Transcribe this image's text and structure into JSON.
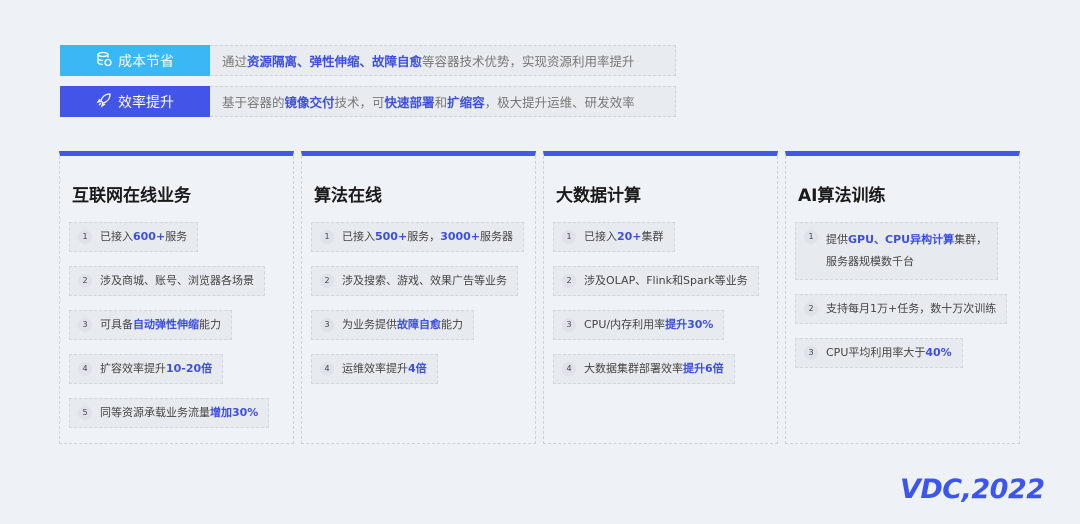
{
  "banners": [
    {
      "label": "成本节省",
      "icon": "database-coin-icon",
      "color": "#3ab7f5",
      "segments": [
        {
          "t": "通过"
        },
        {
          "t": "资源隔离、弹性伸缩、故障自愈",
          "hl": true
        },
        {
          "t": "等容器技术优势，实现资源利用率提升"
        }
      ]
    },
    {
      "label": "效率提升",
      "icon": "rocket-icon",
      "color": "#4255e8",
      "segments": [
        {
          "t": "基于容器的"
        },
        {
          "t": "镜像交付",
          "hl": true
        },
        {
          "t": "技术，可"
        },
        {
          "t": "快速部署",
          "hl": true
        },
        {
          "t": "和"
        },
        {
          "t": "扩缩容",
          "hl": true
        },
        {
          "t": "，极大提升运维、研发效率"
        }
      ]
    }
  ],
  "cards": [
    {
      "title": "互联网在线业务",
      "items": [
        [
          [
            {
              "t": "已接入"
            },
            {
              "t": "600+",
              "hl": true
            },
            {
              "t": "服务"
            }
          ]
        ],
        [
          [
            {
              "t": "涉及商城、账号、浏览器各场景"
            }
          ]
        ],
        [
          [
            {
              "t": "可具备"
            },
            {
              "t": "自动弹性伸缩",
              "hl": true
            },
            {
              "t": "能力"
            }
          ]
        ],
        [
          [
            {
              "t": "扩容效率提升"
            },
            {
              "t": "10-20倍",
              "hl": true
            }
          ]
        ],
        [
          [
            {
              "t": "同等资源承载业务流量"
            },
            {
              "t": "增加30%",
              "hl": true
            }
          ]
        ]
      ]
    },
    {
      "title": "算法在线",
      "items": [
        [
          [
            {
              "t": "已接入"
            },
            {
              "t": "500+",
              "hl": true
            },
            {
              "t": "服务，"
            },
            {
              "t": "3000+",
              "hl": true
            },
            {
              "t": "服务器"
            }
          ]
        ],
        [
          [
            {
              "t": "涉及搜索、游戏、效果广告等业务"
            }
          ]
        ],
        [
          [
            {
              "t": "为业务提供"
            },
            {
              "t": "故障自愈",
              "hl": true
            },
            {
              "t": "能力"
            }
          ]
        ],
        [
          [
            {
              "t": "运维效率提升"
            },
            {
              "t": "4倍",
              "hl": true
            }
          ]
        ]
      ]
    },
    {
      "title": "大数据计算",
      "items": [
        [
          [
            {
              "t": "已接入"
            },
            {
              "t": "20+",
              "hl": true
            },
            {
              "t": "集群"
            }
          ]
        ],
        [
          [
            {
              "t": "涉及OLAP、Flink和Spark等业务"
            }
          ]
        ],
        [
          [
            {
              "t": "CPU/内存利用率"
            },
            {
              "t": "提升30%",
              "hl": true
            }
          ]
        ],
        [
          [
            {
              "t": "大数据集群部署效率"
            },
            {
              "t": "提升6倍",
              "hl": true
            }
          ]
        ]
      ]
    },
    {
      "title": "AI算法训练",
      "items": [
        [
          [
            {
              "t": "提供"
            },
            {
              "t": "GPU、CPU异构计算",
              "hl": true
            },
            {
              "t": "集群，"
            }
          ],
          [
            {
              "t": "服务器规模数千台"
            }
          ]
        ],
        [
          [
            {
              "t": "支持每月1万+任务，数十万次训练"
            }
          ]
        ],
        [
          [
            {
              "t": "CPU平均利用率大于"
            },
            {
              "t": "40%",
              "hl": true
            }
          ]
        ]
      ]
    }
  ],
  "logo": "VDC,2022"
}
